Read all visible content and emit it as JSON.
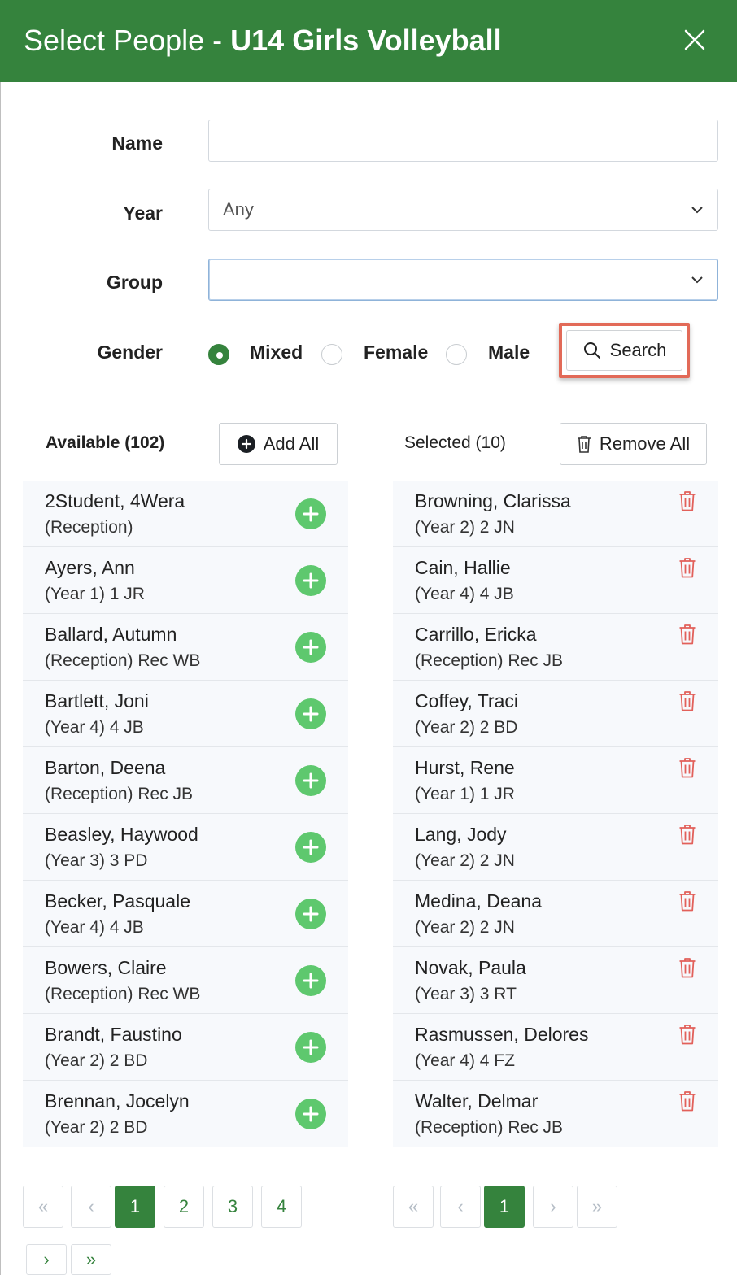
{
  "header": {
    "title_prefix": "Select People - ",
    "title_bold": "U14 Girls Volleyball"
  },
  "form": {
    "name_label": "Name",
    "name_value": "",
    "year_label": "Year",
    "year_value": "Any",
    "group_label": "Group",
    "group_value": "",
    "gender_label": "Gender",
    "gender_options": [
      {
        "label": "Mixed",
        "checked": true
      },
      {
        "label": "Female",
        "checked": false
      },
      {
        "label": "Male",
        "checked": false
      }
    ],
    "search_label": "Search"
  },
  "available": {
    "heading": "Available (102)",
    "add_all_label": "Add All",
    "items": [
      {
        "name": "2Student, 4Wera",
        "sub": "(Reception)"
      },
      {
        "name": "Ayers, Ann",
        "sub": "(Year 1) 1 JR"
      },
      {
        "name": "Ballard, Autumn",
        "sub": "(Reception) Rec WB"
      },
      {
        "name": "Bartlett, Joni",
        "sub": "(Year 4) 4 JB"
      },
      {
        "name": "Barton, Deena",
        "sub": "(Reception) Rec JB"
      },
      {
        "name": "Beasley, Haywood",
        "sub": "(Year 3) 3 PD"
      },
      {
        "name": "Becker, Pasquale",
        "sub": "(Year 4) 4 JB"
      },
      {
        "name": "Bowers, Claire",
        "sub": "(Reception) Rec WB"
      },
      {
        "name": "Brandt, Faustino",
        "sub": "(Year 2) 2 BD"
      },
      {
        "name": "Brennan, Jocelyn",
        "sub": "(Year 2) 2 BD"
      }
    ],
    "pager": {
      "first": "«",
      "prev": "‹",
      "pages": [
        "1",
        "2",
        "3",
        "4"
      ],
      "active": "1",
      "next": "›",
      "last": "»"
    }
  },
  "selected": {
    "heading": "Selected (10)",
    "remove_all_label": "Remove All",
    "items": [
      {
        "name": "Browning, Clarissa",
        "sub": "(Year 2) 2 JN"
      },
      {
        "name": "Cain, Hallie",
        "sub": "(Year 4) 4 JB"
      },
      {
        "name": "Carrillo, Ericka",
        "sub": "(Reception) Rec JB"
      },
      {
        "name": "Coffey, Traci",
        "sub": "(Year 2) 2 BD"
      },
      {
        "name": "Hurst, Rene",
        "sub": "(Year 1) 1 JR"
      },
      {
        "name": "Lang, Jody",
        "sub": "(Year 2) 2 JN"
      },
      {
        "name": "Medina, Deana",
        "sub": "(Year 2) 2 JN"
      },
      {
        "name": "Novak, Paula",
        "sub": "(Year 3) 3 RT"
      },
      {
        "name": "Rasmussen, Delores",
        "sub": "(Year 4) 4 FZ"
      },
      {
        "name": "Walter, Delmar",
        "sub": "(Reception) Rec JB"
      }
    ],
    "pager": {
      "first": "«",
      "prev": "‹",
      "pages": [
        "1"
      ],
      "active": "1",
      "next": "›",
      "last": "»"
    }
  },
  "colors": {
    "brand_green": "#35833d",
    "add_green": "#5ec86e",
    "delete_red": "#e2605a",
    "highlight": "#e26a58"
  }
}
